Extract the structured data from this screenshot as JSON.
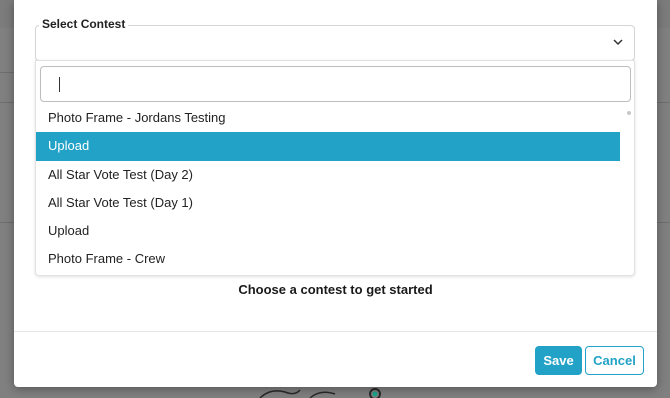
{
  "modal": {
    "select_label": "Select Contest",
    "search": {
      "value": "",
      "placeholder": ""
    },
    "options": [
      {
        "label": "Photo Frame - Jordans Testing",
        "selected": false
      },
      {
        "label": "Upload",
        "selected": true
      },
      {
        "label": "All Star Vote Test (Day 2)",
        "selected": false
      },
      {
        "label": "All Star Vote Test (Day 1)",
        "selected": false
      },
      {
        "label": "Upload",
        "selected": false
      },
      {
        "label": "Photo Frame - Crew",
        "selected": false
      }
    ],
    "prompt": "Choose a contest to get started",
    "save_label": "Save",
    "cancel_label": "Cancel"
  },
  "background": {
    "toolbar_icons": [
      "user-icon",
      "image-icon",
      "help-icon",
      "bell-icon",
      "check-icon",
      "search-icon"
    ]
  },
  "colors": {
    "accent": "#23a2c7",
    "overlay": "#808080"
  }
}
